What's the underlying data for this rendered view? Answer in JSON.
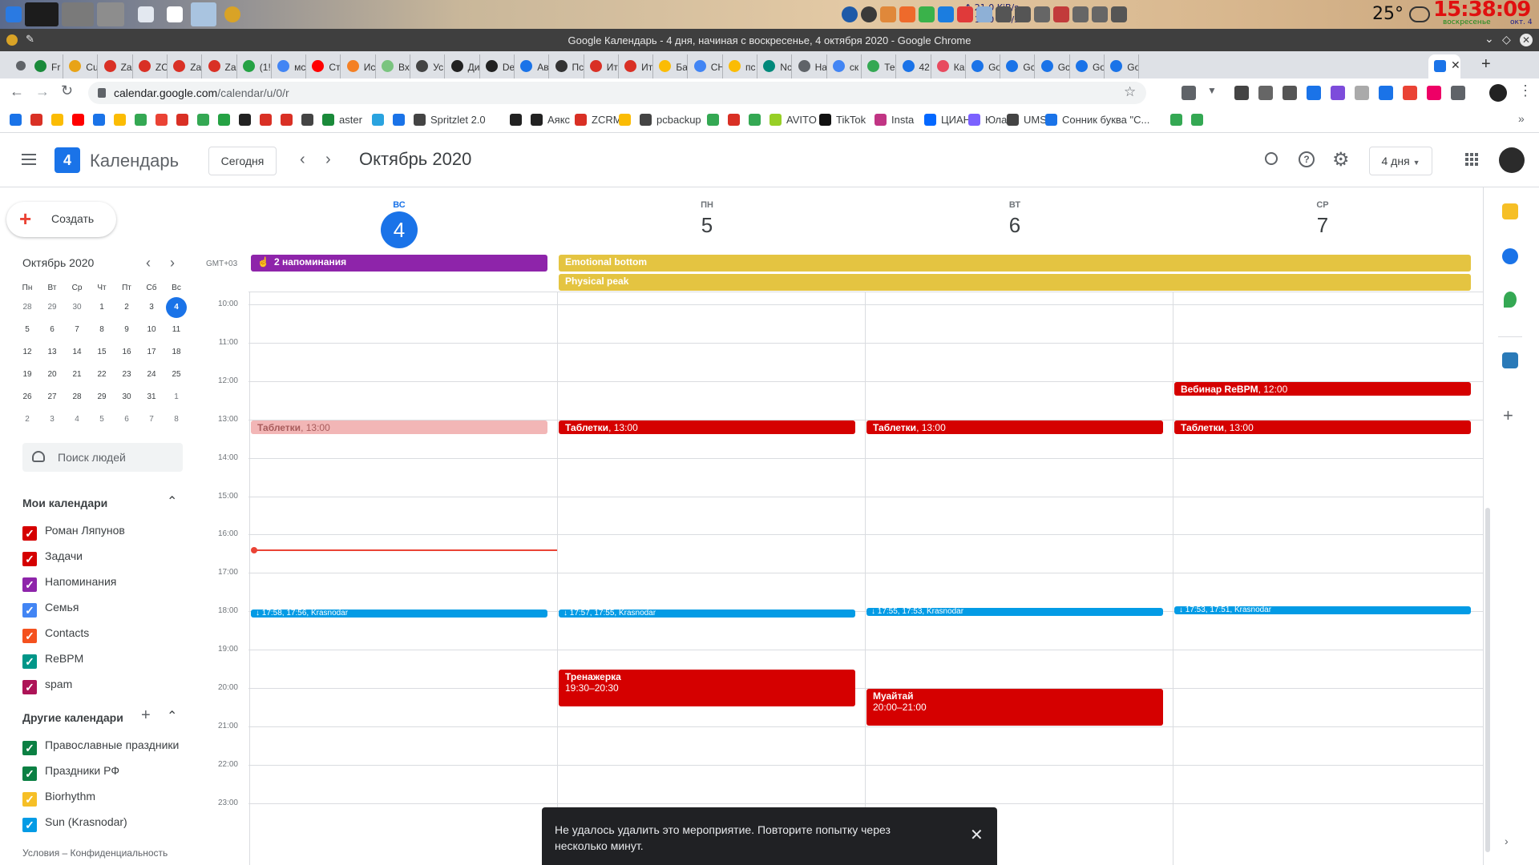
{
  "taskbar": {
    "net_up": "21.0 KiB/s",
    "net_down": "17.0 KiB/s",
    "temperature": "25°",
    "clock": "15:38:09",
    "date_label": "воскресенье",
    "date_short": "окт. 4"
  },
  "window": {
    "title": "Google Календарь - 4 дня, начиная с воскресенье, 4 октября 2020 - Google Chrome"
  },
  "tabs": [
    {
      "label": "Fr",
      "color": "#1a8a3a"
    },
    {
      "label": "Cu",
      "color": "#e8a317"
    },
    {
      "label": "Za",
      "color": "#d93025"
    },
    {
      "label": "ZC",
      "color": "#d93025"
    },
    {
      "label": "Za",
      "color": "#d93025"
    },
    {
      "label": "Za",
      "color": "#d93025"
    },
    {
      "label": "(1!",
      "color": "#25a244"
    },
    {
      "label": "мс",
      "color": "#4285f4"
    },
    {
      "label": "Ст",
      "color": "#ff0000"
    },
    {
      "label": "Ис",
      "color": "#f48024"
    },
    {
      "label": "Вх",
      "color": "#7ac47f"
    },
    {
      "label": "Ус",
      "color": "#444"
    },
    {
      "label": "Ди",
      "color": "#222"
    },
    {
      "label": "De",
      "color": "#222"
    },
    {
      "label": "Ав",
      "color": "#1a73e8"
    },
    {
      "label": "Пс",
      "color": "#333"
    },
    {
      "label": "Ит",
      "color": "#d93025"
    },
    {
      "label": "Ит",
      "color": "#d93025"
    },
    {
      "label": "Ба",
      "color": "#fbbc04"
    },
    {
      "label": "СН",
      "color": "#4285f4"
    },
    {
      "label": "пс",
      "color": "#fbbc04"
    },
    {
      "label": "Nc",
      "color": "#00897b"
    },
    {
      "label": "На",
      "color": "#5f6368"
    },
    {
      "label": "ск",
      "color": "#4285f4"
    },
    {
      "label": "Те",
      "color": "#34a853"
    },
    {
      "label": "42",
      "color": "#1a73e8"
    },
    {
      "label": "Ка",
      "color": "#e84a5f"
    },
    {
      "label": "Go",
      "color": "#1a73e8"
    },
    {
      "label": "Gc",
      "color": "#1a73e8"
    },
    {
      "label": "Gc",
      "color": "#1a73e8"
    },
    {
      "label": "Go",
      "color": "#1a73e8"
    },
    {
      "label": "Go",
      "color": "#1a73e8"
    }
  ],
  "omnibox": {
    "url_host": "calendar.google.com",
    "url_path": "/calendar/u/0/r"
  },
  "bookmarks": [
    {
      "label": "",
      "color": "#1a73e8"
    },
    {
      "label": "",
      "color": "#d93025"
    },
    {
      "label": "",
      "color": "#fbbc04"
    },
    {
      "label": "",
      "color": "#ff0000"
    },
    {
      "label": "",
      "color": "#1a73e8"
    },
    {
      "label": "",
      "color": "#fbbc04"
    },
    {
      "label": "",
      "color": "#34a853"
    },
    {
      "label": "",
      "color": "#ea4335"
    },
    {
      "label": "",
      "color": "#d93025"
    },
    {
      "label": "",
      "color": "#34a853"
    },
    {
      "label": "",
      "color": "#25a244"
    },
    {
      "label": "",
      "color": "#222"
    },
    {
      "label": "",
      "color": "#d93025"
    },
    {
      "label": "",
      "color": "#d93025"
    },
    {
      "label": "",
      "color": "#444"
    },
    {
      "label": "aster",
      "color": "#1a8a3a"
    },
    {
      "label": "",
      "color": "#2aa3df"
    },
    {
      "label": "",
      "color": "#1a73e8"
    },
    {
      "label": "Spritzlet 2.0",
      "color": "#444"
    },
    {
      "label": "",
      "color": "#222"
    },
    {
      "label": "Аякс",
      "color": "#222"
    },
    {
      "label": "ZCRM",
      "color": "#d93025"
    },
    {
      "label": "",
      "color": "#fbbc04"
    },
    {
      "label": "pcbackup",
      "color": "#444"
    },
    {
      "label": "",
      "color": "#34a853"
    },
    {
      "label": "",
      "color": "#d93025"
    },
    {
      "label": "",
      "color": "#34a853"
    },
    {
      "label": "AVITO",
      "color": "#97cf26"
    },
    {
      "label": "TikTok",
      "color": "#111"
    },
    {
      "label": "Insta",
      "color": "#c13584"
    },
    {
      "label": "ЦИАН",
      "color": "#0468ff"
    },
    {
      "label": "Юла",
      "color": "#7b61ff"
    },
    {
      "label": "UMS",
      "color": "#444"
    },
    {
      "label": "Сонник буква \"С...",
      "color": "#1a73e8"
    },
    {
      "label": "",
      "color": "#34a853"
    },
    {
      "label": "",
      "color": "#34a853"
    }
  ],
  "header": {
    "app_name": "Календарь",
    "logo_day": "4",
    "today_button": "Сегодня",
    "period_title": "Октябрь 2020",
    "view_select": "4 дня"
  },
  "sidebar": {
    "create_button": "Создать",
    "mini_month": "Октябрь 2020",
    "weekdays": [
      "Пн",
      "Вт",
      "Ср",
      "Чт",
      "Пт",
      "Сб",
      "Вс"
    ],
    "weeks": [
      [
        "28",
        "29",
        "30",
        "1",
        "2",
        "3",
        "4"
      ],
      [
        "5",
        "6",
        "7",
        "8",
        "9",
        "10",
        "11"
      ],
      [
        "12",
        "13",
        "14",
        "15",
        "16",
        "17",
        "18"
      ],
      [
        "19",
        "20",
        "21",
        "22",
        "23",
        "24",
        "25"
      ],
      [
        "26",
        "27",
        "28",
        "29",
        "30",
        "31",
        "1"
      ],
      [
        "2",
        "3",
        "4",
        "5",
        "6",
        "7",
        "8"
      ]
    ],
    "search_people": "Поиск людей",
    "my_calendars_title": "Мои календари",
    "my_calendars": [
      {
        "name": "Роман Ляпунов",
        "color": "#d50000"
      },
      {
        "name": "Задачи",
        "color": "#d50000"
      },
      {
        "name": "Напоминания",
        "color": "#8e24aa"
      },
      {
        "name": "Семья",
        "color": "#4285f4"
      },
      {
        "name": "Contacts",
        "color": "#f4511e"
      },
      {
        "name": "ReBPM",
        "color": "#009688"
      },
      {
        "name": "spam",
        "color": "#ad1457"
      }
    ],
    "other_calendars_title": "Другие календари",
    "other_calendars": [
      {
        "name": "Православные праздники",
        "color": "#0b8043"
      },
      {
        "name": "Праздники РФ",
        "color": "#0b8043"
      },
      {
        "name": "Biorhythm",
        "color": "#f6bf26"
      },
      {
        "name": "Sun (Krasnodar)",
        "color": "#039be5"
      }
    ],
    "footer": "Условия – Конфиденциальность"
  },
  "grid": {
    "timezone": "GMT+03",
    "days": [
      {
        "name": "ВС",
        "num": "4",
        "today": true
      },
      {
        "name": "ПН",
        "num": "5",
        "today": false
      },
      {
        "name": "ВТ",
        "num": "6",
        "today": false
      },
      {
        "name": "СР",
        "num": "7",
        "today": false
      }
    ],
    "hours": [
      "10:00",
      "11:00",
      "12:00",
      "13:00",
      "14:00",
      "15:00",
      "16:00",
      "17:00",
      "18:00",
      "19:00",
      "20:00",
      "21:00",
      "22:00",
      "23:00"
    ],
    "allday": [
      {
        "title": "2 напоминания",
        "color": "#8e24aa"
      },
      {
        "title": "Emotional bottom",
        "color": "#e4c441"
      },
      {
        "title": "Physical peak",
        "color": "#e4c441"
      }
    ],
    "events": [
      {
        "title": "Вебинар ReBPM",
        "time": "12:00",
        "color": "#d50000"
      },
      {
        "title": "Таблетки",
        "time": "13:00",
        "color": "#f2b6b6"
      },
      {
        "title": "Таблетки",
        "time": "13:00",
        "color": "#d50000"
      },
      {
        "title": "Таблетки",
        "time": "13:00",
        "color": "#d50000"
      },
      {
        "title": "Таблетки",
        "time": "13:00",
        "color": "#d50000"
      },
      {
        "title": "Тренажерка",
        "time": "19:30–20:30",
        "color": "#d50000"
      },
      {
        "title": "Муайтай",
        "time": "20:00–21:00",
        "color": "#d50000"
      }
    ],
    "sun_events": [
      {
        "title": "↓ 17:58, 17:56, Krasnodar"
      },
      {
        "title": "↓ 17:57, 17:55, Krasnodar"
      },
      {
        "title": "↓ 17:55, 17:53, Krasnodar"
      },
      {
        "title": "↓ 17:53, 17:51, Krasnodar"
      }
    ]
  },
  "toast": {
    "message": "Не удалось удалить это мероприятие. Повторите попытку через несколько минут."
  }
}
